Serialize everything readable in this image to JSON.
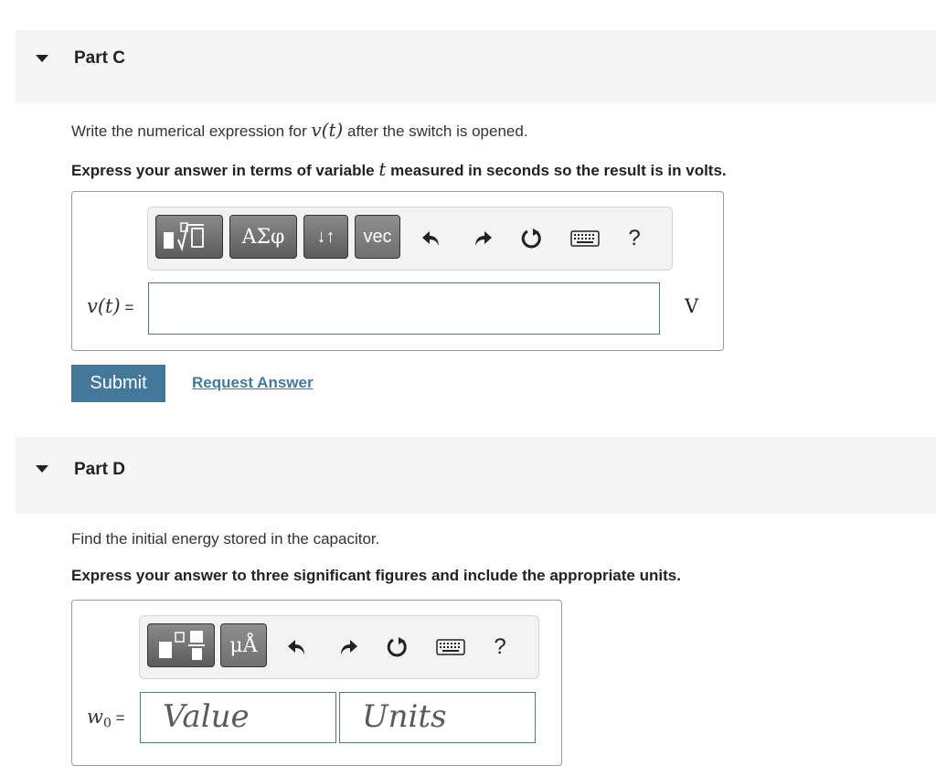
{
  "part_c": {
    "title": "Part C",
    "instruction_pre": "Write the numerical expression for ",
    "instruction_math": "v(t)",
    "instruction_post": " after the switch is opened.",
    "express_pre": "Express your answer in terms of variable ",
    "express_var": "t",
    "express_post": " measured in seconds so the result is in volts.",
    "toolbar": {
      "templates_icon": "template-radical-icon",
      "greek_label": "ΑΣφ",
      "arrows_label": "↓↑",
      "vec_label": "vec",
      "help_label": "?"
    },
    "answer_label_math": "v(t)",
    "answer_label_eq": " =",
    "answer_value": "",
    "unit": "V",
    "submit_label": "Submit",
    "request_label": "Request Answer"
  },
  "part_d": {
    "title": "Part D",
    "instruction": "Find the initial energy stored in the capacitor.",
    "express": "Express your answer to three significant figures and include the appropriate units.",
    "toolbar": {
      "templates_icon": "template-fraction-icon",
      "units_label": "μÅ",
      "help_label": "?"
    },
    "answer_label_math": "w",
    "answer_label_sub": "0",
    "answer_label_eq": " =",
    "value_placeholder": "Value",
    "units_placeholder": "Units"
  }
}
